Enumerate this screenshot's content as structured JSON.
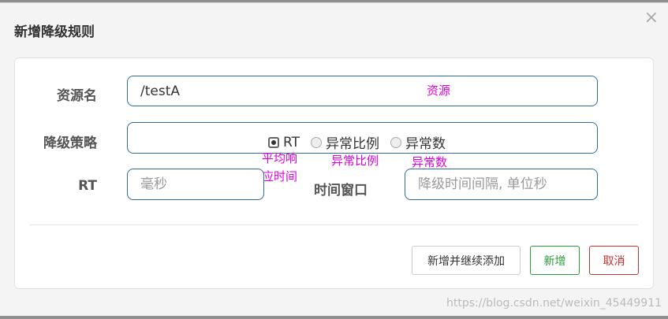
{
  "dialog": {
    "title": "新增降级规则",
    "close": "×"
  },
  "form": {
    "resource_label": "资源名",
    "resource_value": "/testA",
    "strategy_label": "降级策略",
    "strategy_options": [
      {
        "label": "RT",
        "checked": true
      },
      {
        "label": "异常比例",
        "checked": false
      },
      {
        "label": "异常数",
        "checked": false
      }
    ],
    "rt_label": "RT",
    "rt_placeholder": "毫秒",
    "window_label": "时间窗口",
    "window_placeholder": "降级时间间隔, 单位秒"
  },
  "annotations": {
    "resource": "资源",
    "rt_line1": "平均响",
    "rt_line2": "应时间",
    "ratio": "异常比例",
    "count": "异常数"
  },
  "buttons": {
    "add_continue": "新增并继续添加",
    "add": "新增",
    "cancel": "取消"
  },
  "colors": {
    "add": "#2a9a3a",
    "cancel": "#c9302c",
    "annotation": "#e000e0",
    "input_border": "#2e6da4"
  },
  "watermark": "https://blog.csdn.net/weixin_45449911"
}
